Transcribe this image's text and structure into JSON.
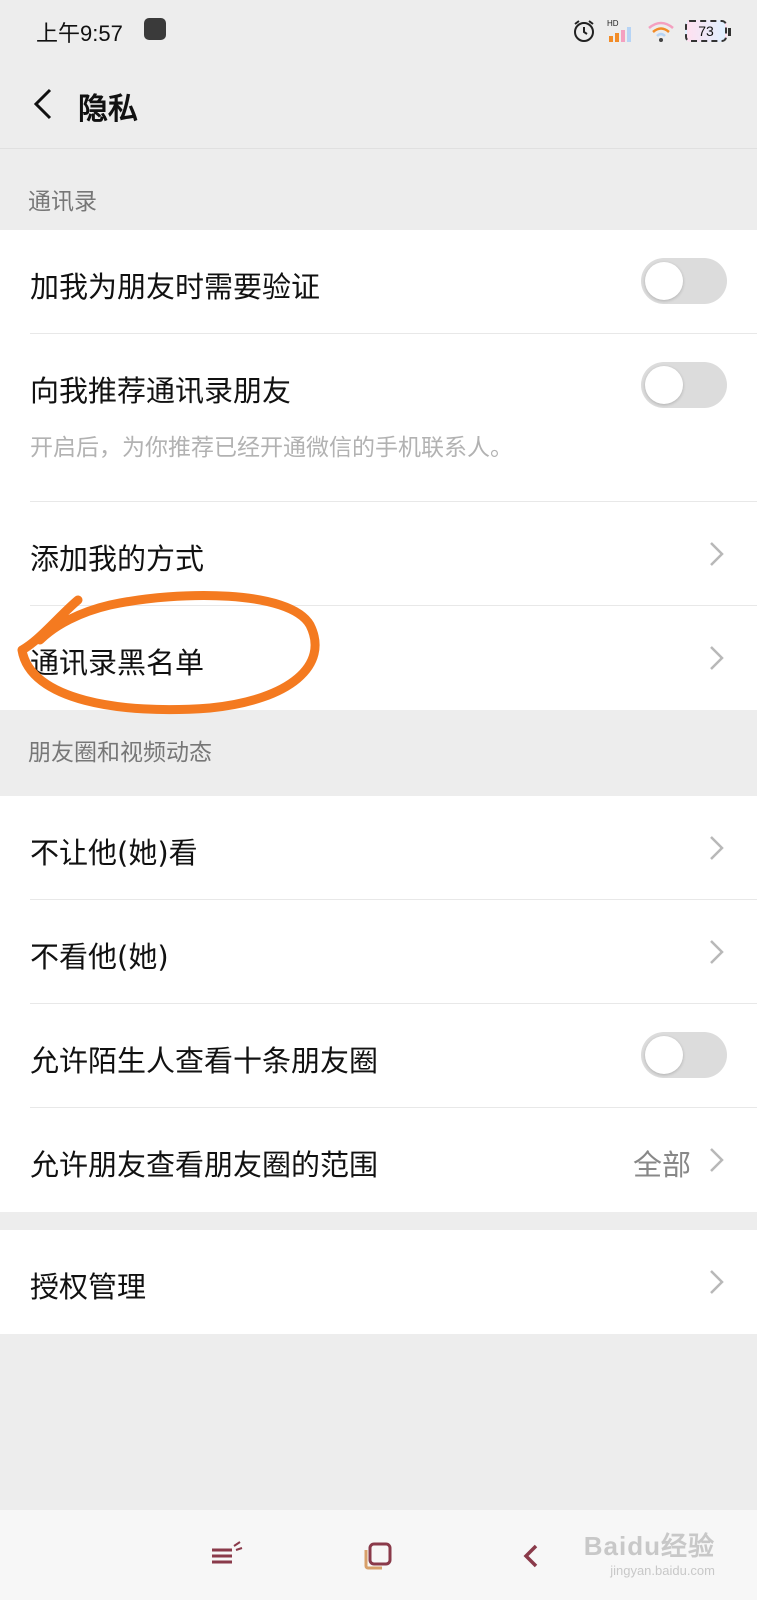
{
  "status_bar": {
    "time": "上午9:57",
    "battery": "73",
    "icons": [
      "app-notification-icon",
      "alarm-icon",
      "hd-signal-icon",
      "wifi-icon",
      "battery-icon"
    ]
  },
  "nav": {
    "title": "隐私",
    "back_icon": "chevron-left-icon"
  },
  "sections": {
    "contacts": {
      "header": "通讯录",
      "rows": [
        {
          "label": "加我为朋友时需要验证",
          "control": "toggle",
          "on": false
        },
        {
          "label": "向我推荐通讯录朋友",
          "sub": "开启后，为你推荐已经开通微信的手机联系人。",
          "control": "toggle",
          "on": false
        },
        {
          "label": "添加我的方式",
          "control": "chevron"
        },
        {
          "label": "通讯录黑名单",
          "control": "chevron"
        }
      ]
    },
    "moments": {
      "header": "朋友圈和视频动态",
      "rows": [
        {
          "label": "不让他(她)看",
          "control": "chevron"
        },
        {
          "label": "不看他(她)",
          "control": "chevron"
        },
        {
          "label": "允许陌生人查看十条朋友圈",
          "control": "toggle",
          "on": false
        },
        {
          "label": "允许朋友查看朋友圈的范围",
          "value": "全部",
          "control": "chevron"
        }
      ]
    },
    "auth": {
      "rows": [
        {
          "label": "授权管理",
          "control": "chevron"
        }
      ]
    }
  },
  "bottom_bar": {
    "icons": [
      "menu-icon",
      "home-square-icon",
      "back-arrow-icon"
    ]
  },
  "watermark": {
    "logo": "Baidu经验",
    "url": "jingyan.baidu.com"
  },
  "colors": {
    "background": "#ededed",
    "card": "#ffffff",
    "annotation": "#f47a20",
    "toggle_off": "#dcdcdc"
  }
}
